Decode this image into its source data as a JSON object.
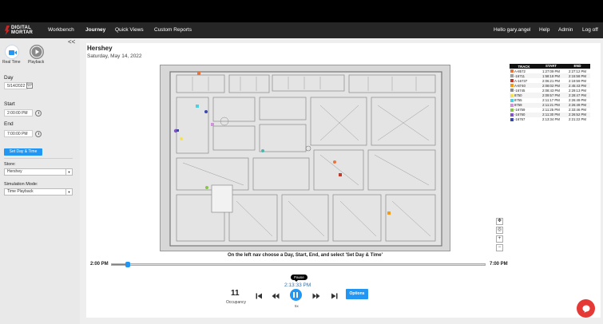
{
  "nav": {
    "logo_line1": "DIGITAL",
    "logo_line2": "MORTAR",
    "items": [
      "Workbench",
      "Journey",
      "Quick Views",
      "Custom Reports"
    ],
    "active_item": "Journey",
    "greeting": "Hello gary.angel",
    "help": "Help",
    "admin": "Admin",
    "logoff": "Log off"
  },
  "sidebar": {
    "collapse_glyph": "<<",
    "mode_realtime": "Real Time",
    "mode_playback": "Playback",
    "day_label": "Day",
    "day_value": "5/14/2022",
    "start_label": "Start",
    "start_value": "2:00:00 PM",
    "end_label": "End",
    "end_value": "7:00:00 PM",
    "set_button": "Set Day & Time",
    "store_label": "Store:",
    "store_value": "Hershey",
    "sim_label": "Simulation Mode:",
    "sim_value": "Time Playback"
  },
  "page": {
    "title": "Hershey",
    "subtitle": "Saturday, May 14, 2022",
    "instruction": "On the left nav choose a Day, Start, End, and select 'Set Day & Time'"
  },
  "legend": {
    "headers": [
      "TRACK",
      "START",
      "END"
    ],
    "rows": [
      {
        "track": "A-8572",
        "start": "1:27:09 PM",
        "end": "2:27:12 PM",
        "color": "#e8743b"
      },
      {
        "track": "-16711",
        "start": "1:58:18 PM",
        "end": "2:15:58 PM",
        "color": "#9e9e9e"
      },
      {
        "track": "A-16737",
        "start": "2:06:21 PM",
        "end": "2:19:59 PM",
        "color": "#c0392b"
      },
      {
        "track": "A-8740",
        "start": "2:08:02 PM",
        "end": "2:45:43 PM",
        "color": "#f39c12"
      },
      {
        "track": "-16745",
        "start": "2:08:43 PM",
        "end": "2:29:13 PM",
        "color": "#8d8d8d"
      },
      {
        "track": "8750",
        "start": "2:09:57 PM",
        "end": "2:28:47 PM",
        "color": "#f1e05a"
      },
      {
        "track": "8755",
        "start": "2:11:17 PM",
        "end": "2:26:49 PM",
        "color": "#4dd0e1"
      },
      {
        "track": "8759",
        "start": "2:11:21 PM",
        "end": "2:26:49 PM",
        "color": "#ce93d8"
      },
      {
        "track": "-16759",
        "start": "2:11:25 PM",
        "end": "2:33:46 PM",
        "color": "#8bc34a"
      },
      {
        "track": "-16760",
        "start": "2:11:30 PM",
        "end": "2:26:52 PM",
        "color": "#7e57c2"
      },
      {
        "track": "-16767",
        "start": "2:13:34 PM",
        "end": "2:21:22 PM",
        "color": "#3949ab"
      }
    ]
  },
  "timeline": {
    "start_label": "2:00 PM",
    "end_label": "7:00 PM",
    "progress_fraction": 0.045,
    "tooltip": "Pause",
    "current_time": "2:13:33 PM",
    "occupancy_value": "11",
    "occupancy_label": "Occupancy",
    "speed": "5x",
    "options_button": "Options"
  }
}
